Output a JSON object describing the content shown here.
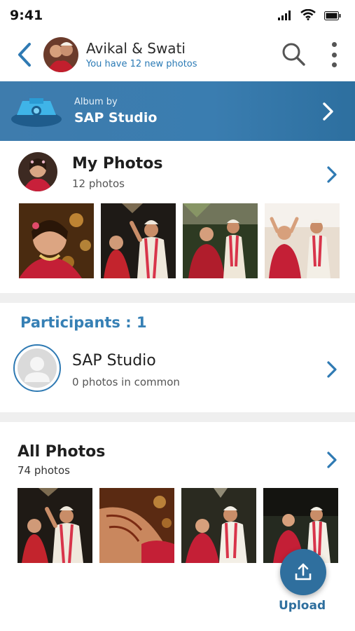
{
  "status_bar": {
    "time": "9:41",
    "icons": [
      "signal-icon",
      "wifi-icon",
      "battery-icon"
    ]
  },
  "header": {
    "title": "Avikal & Swati",
    "subtitle": "You have 12 new photos",
    "icons": [
      "back-icon",
      "search-icon",
      "more-vertical-icon"
    ]
  },
  "album": {
    "label": "Album by",
    "studio_name": "SAP Studio",
    "logo_text": "SAP Studio"
  },
  "my_photos": {
    "title": "My Photos",
    "count": "12 photos",
    "thumbnails": 4
  },
  "participants": {
    "title": "Participants : 1",
    "items": [
      {
        "name": "SAP Studio",
        "detail": "0 photos in common"
      }
    ]
  },
  "all_photos": {
    "title": "All Photos",
    "count": "74 photos",
    "thumbnails": 4
  },
  "upload": {
    "label": "Upload"
  },
  "colors": {
    "accent": "#2f7ab3",
    "banner": "#3a7db0",
    "fab": "#2f6f9e",
    "separator": "#efefef"
  }
}
